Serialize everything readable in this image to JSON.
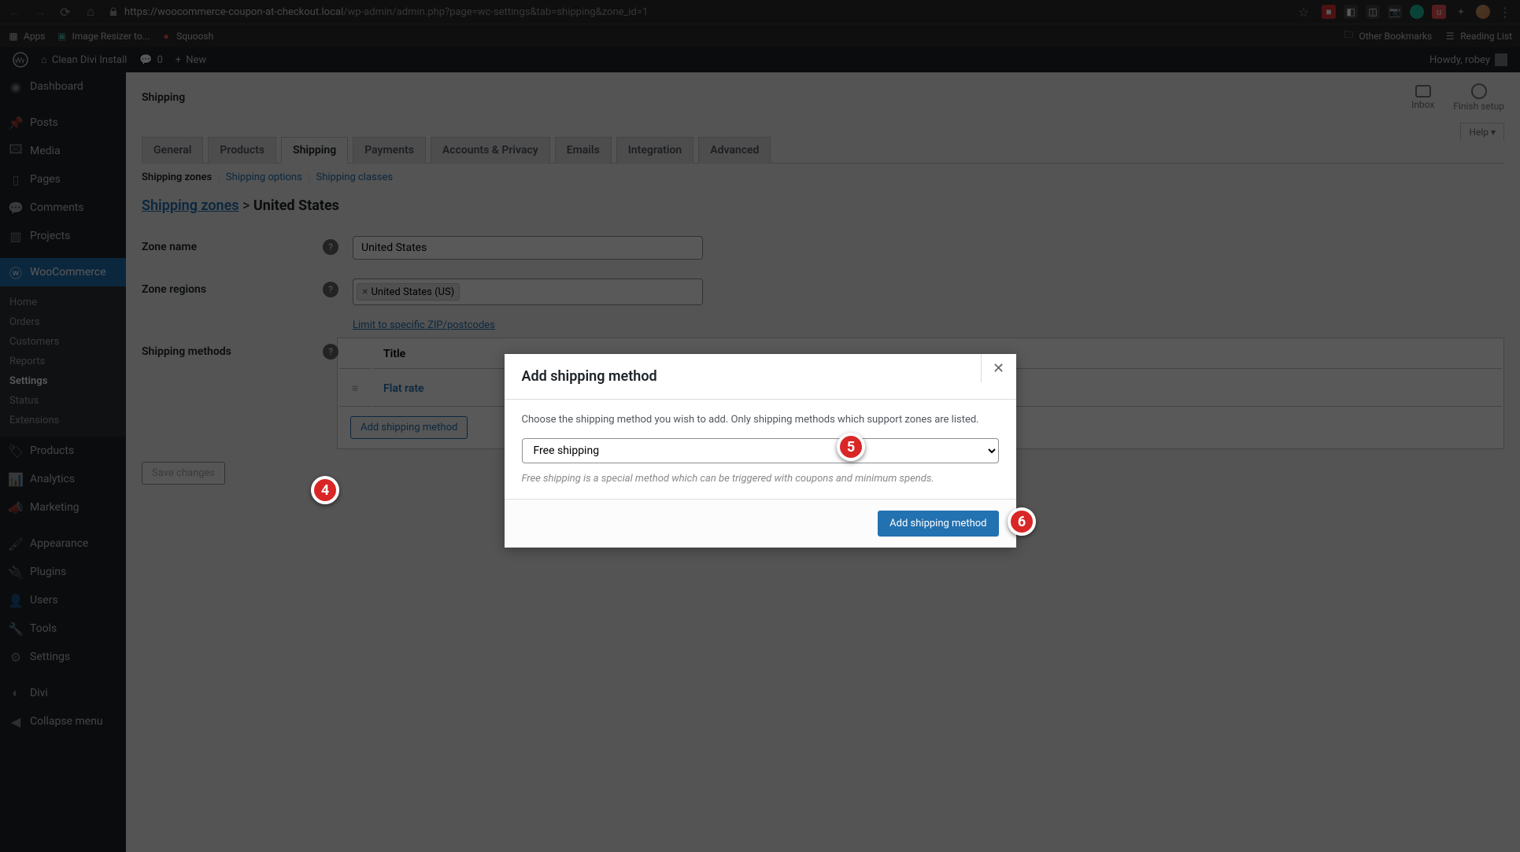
{
  "browser": {
    "url_host": "https://woocommerce-coupon-at-checkout.local",
    "url_path": "/wp-admin/admin.php?page=wc-settings&tab=shipping&zone_id=1",
    "bookmarks": {
      "apps": "Apps",
      "resizer": "Image Resizer to...",
      "squoosh": "Squoosh",
      "other": "Other Bookmarks",
      "reading": "Reading List"
    }
  },
  "adminbar": {
    "site": "Clean Divi Install",
    "comments": "0",
    "new": "New",
    "howdy": "Howdy, robey"
  },
  "sidebar": {
    "dashboard": "Dashboard",
    "posts": "Posts",
    "media": "Media",
    "pages": "Pages",
    "comments": "Comments",
    "projects": "Projects",
    "woocommerce": "WooCommerce",
    "woo_sub": {
      "home": "Home",
      "orders": "Orders",
      "customers": "Customers",
      "reports": "Reports",
      "settings": "Settings",
      "status": "Status",
      "extensions": "Extensions"
    },
    "products": "Products",
    "analytics": "Analytics",
    "marketing": "Marketing",
    "appearance": "Appearance",
    "plugins": "Plugins",
    "users": "Users",
    "tools": "Tools",
    "settings": "Settings",
    "divi": "Divi",
    "collapse": "Collapse menu"
  },
  "page": {
    "title": "Shipping",
    "inbox": "Inbox",
    "finish": "Finish setup",
    "help": "Help",
    "tabs": {
      "general": "General",
      "products": "Products",
      "shipping": "Shipping",
      "payments": "Payments",
      "accounts": "Accounts & Privacy",
      "emails": "Emails",
      "integration": "Integration",
      "advanced": "Advanced"
    },
    "subnav": {
      "zones": "Shipping zones",
      "options": "Shipping options",
      "classes": "Shipping classes"
    },
    "breadcrumb_link": "Shipping zones",
    "breadcrumb_sep": " > ",
    "breadcrumb_current": "United States",
    "zone_name_label": "Zone name",
    "zone_name_value": "United States",
    "zone_regions_label": "Zone regions",
    "zone_regions_tag": "United States (US)",
    "zip_link": "Limit to specific ZIP/postcodes",
    "methods_label": "Shipping methods",
    "table_title": "Title",
    "table_value": "Flat rate",
    "add_method_btn": "Add shipping method",
    "save": "Save changes"
  },
  "modal": {
    "title": "Add shipping method",
    "desc": "Choose the shipping method you wish to add. Only shipping methods which support zones are listed.",
    "selected": "Free shipping",
    "hint": "Free shipping is a special method which can be triggered with coupons and minimum spends.",
    "submit": "Add shipping method"
  },
  "annotations": {
    "a4": "4",
    "a5": "5",
    "a6": "6"
  }
}
